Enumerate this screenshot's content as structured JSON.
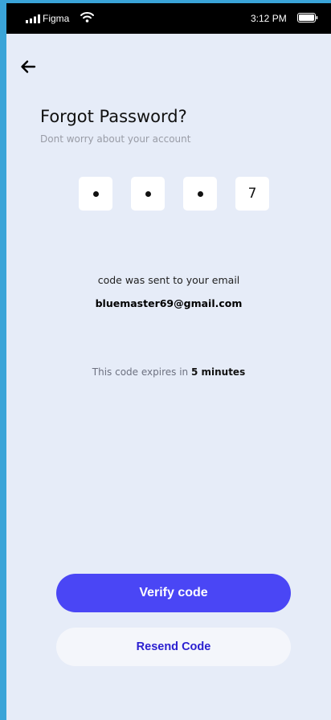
{
  "status_bar": {
    "carrier": "Figma",
    "time": "3:12 PM",
    "icons": [
      "signal-icon",
      "wifi-icon",
      "battery-icon"
    ]
  },
  "nav": {
    "back_icon": "arrow-left-icon"
  },
  "header": {
    "title": "Forgot Password?",
    "subtitle": "Dont worry about your account"
  },
  "code": {
    "digits": [
      "•",
      "•",
      "•",
      "7"
    ],
    "masked": [
      true,
      true,
      true,
      false
    ]
  },
  "message": {
    "sent_text": "code was sent to your email",
    "email": "bluemaster69@gmail.com",
    "expires_prefix": "This code expires in ",
    "expires_value": "5 minutes"
  },
  "actions": {
    "verify_label": "Verify code",
    "resend_label": "Resend Code"
  },
  "colors": {
    "background": "#e6ecf8",
    "primary": "#4a46f5",
    "resend_text": "#2a1fd0",
    "outer_frame": "#3aa4d8"
  }
}
